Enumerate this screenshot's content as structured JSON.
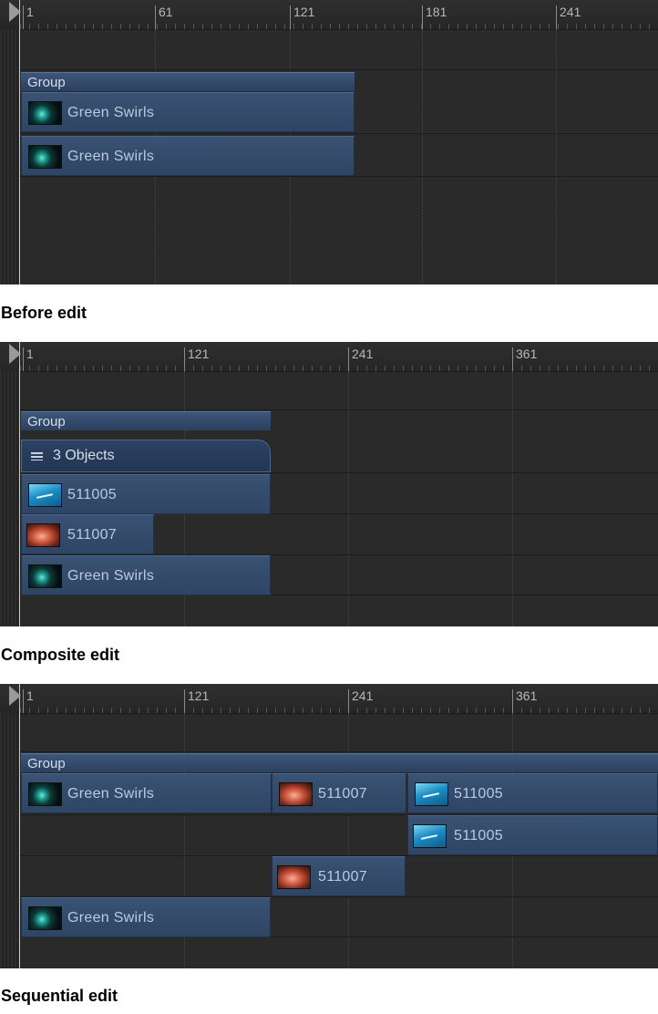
{
  "panels": [
    {
      "ruler_ticks": [
        "1",
        "61",
        "121",
        "181",
        "241"
      ],
      "group_label": "Group",
      "layers": [
        "Green Swirls",
        "Green Swirls"
      ],
      "caption": "Before edit"
    },
    {
      "ruler_ticks": [
        "1",
        "121",
        "241",
        "361"
      ],
      "group_label": "Group",
      "objects_label": "3 Objects",
      "layers": [
        "511005",
        "511007",
        "Green Swirls"
      ],
      "caption": "Composite edit"
    },
    {
      "ruler_ticks": [
        "1",
        "121",
        "241",
        "361"
      ],
      "group_label": "Group",
      "group_clips": [
        "Green Swirls",
        "511007",
        "511005"
      ],
      "layers": [
        "511005",
        "511007",
        "Green Swirls"
      ],
      "caption": "Sequential edit"
    }
  ],
  "colors": {
    "timeline_bg": "#2a2a2a",
    "layer_blue": "#3a5273",
    "group_blue": "#3d5679"
  },
  "icons": [
    "playhead-icon",
    "green-swirls-thumbnail",
    "water-thumbnail",
    "fish-thumbnail",
    "objects-stack-icon"
  ]
}
